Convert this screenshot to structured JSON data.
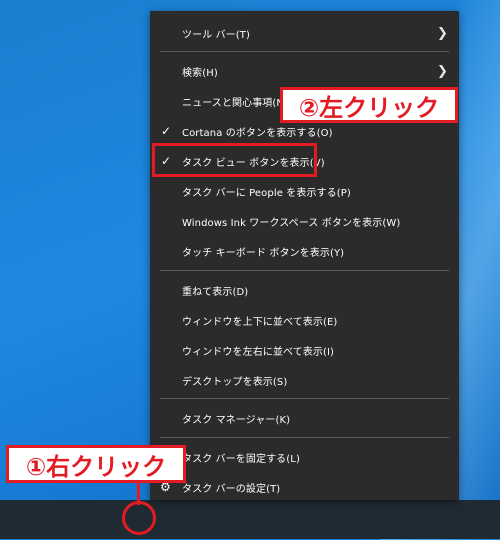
{
  "menu": {
    "items": [
      {
        "label": "ツール バー(T)",
        "has_submenu": true
      },
      {
        "label": "検索(H)",
        "has_submenu": true
      },
      {
        "label": "ニュースと関心事項(N)"
      },
      {
        "label": "Cortana のボタンを表示する(O)",
        "checked": true
      },
      {
        "label": "タスク ビュー ボタンを表示(V)",
        "checked": true
      },
      {
        "label": "タスク バーに People を表示する(P)"
      },
      {
        "label": "Windows Ink ワークスペース ボタンを表示(W)"
      },
      {
        "label": "タッチ キーボード ボタンを表示(Y)"
      },
      {
        "label": "重ねて表示(D)"
      },
      {
        "label": "ウィンドウを上下に並べて表示(E)"
      },
      {
        "label": "ウィンドウを左右に並べて表示(I)"
      },
      {
        "label": "デスクトップを表示(S)"
      },
      {
        "label": "タスク マネージャー(K)"
      },
      {
        "label": "タスク バーを固定する(L)"
      },
      {
        "label": "タスク バーの設定(T)",
        "icon": "gear-icon"
      }
    ],
    "icons": {
      "check": "check-icon",
      "submenu": "chevron-right-icon",
      "settings": "gear-icon"
    }
  },
  "annotations": {
    "left_click": "②左クリック",
    "right_click": "①右クリック"
  },
  "colors": {
    "menu_bg": "#2b2b2b",
    "menu_text": "#ffffff",
    "separator": "#5a5a5a",
    "highlight": "#e31b23",
    "desktop": "#1a7fd0",
    "taskbar": "#1f2a33"
  }
}
